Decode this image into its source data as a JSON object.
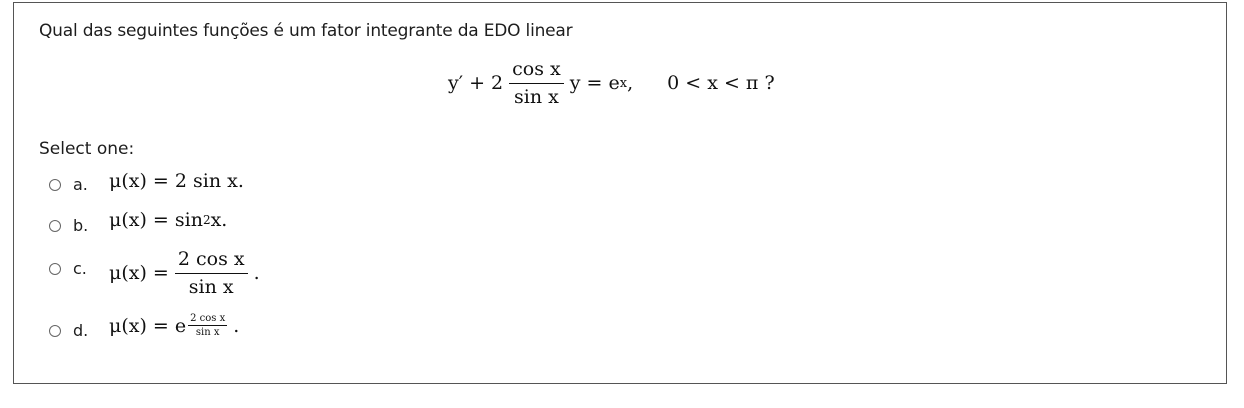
{
  "question": {
    "text": "Qual das seguintes funções é um fator integrante da EDO linear",
    "equation": {
      "lhs_start": "y′ + 2",
      "frac_num": "cos x",
      "frac_den": "sin x",
      "lhs_end": "y = e",
      "exp": "x",
      "comma": ",",
      "condition": "0 < x < π ?"
    }
  },
  "select_label": "Select one:",
  "options": [
    {
      "letter": "a.",
      "expr": "μ(x) = 2 sin x."
    },
    {
      "letter": "b.",
      "prefix": "μ(x) = sin",
      "sup": "2",
      "suffix": " x."
    },
    {
      "letter": "c.",
      "prefix": "μ(x) =",
      "num": "2 cos x",
      "den": "sin x",
      "suffix": "."
    },
    {
      "letter": "d.",
      "prefix": "μ(x) = e",
      "num": "2 cos x",
      "den": "sin x",
      "suffix": "."
    }
  ]
}
